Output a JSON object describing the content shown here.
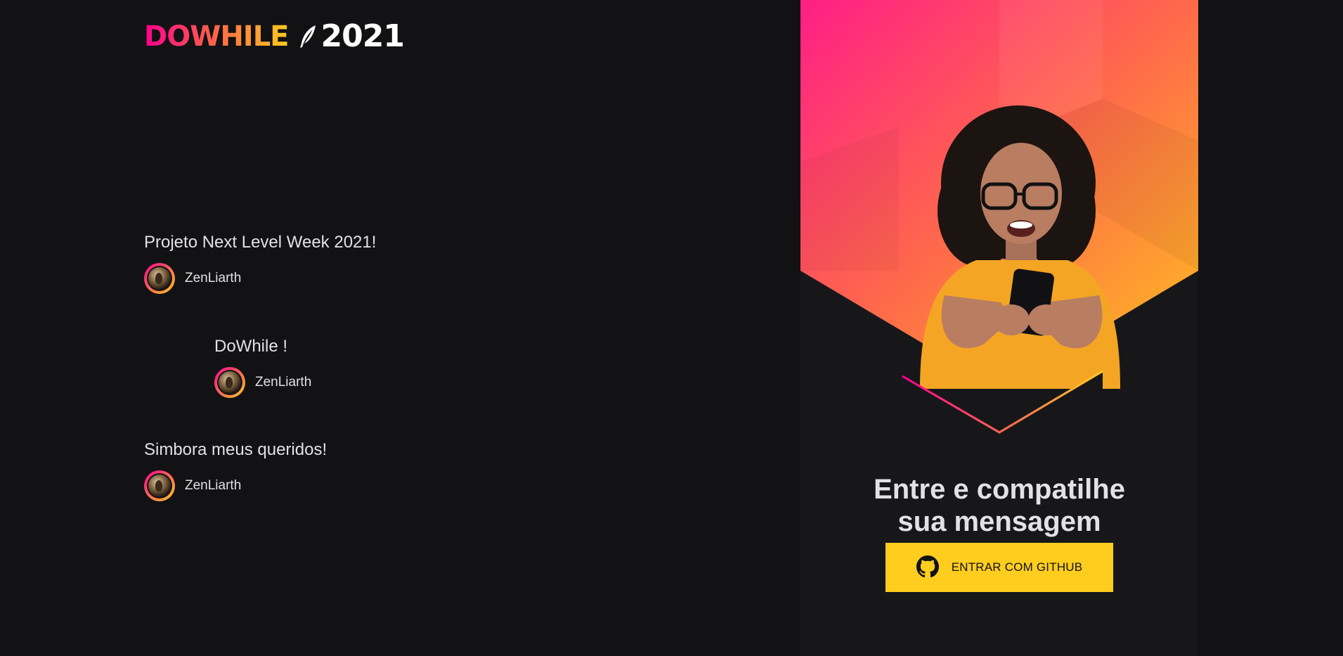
{
  "header": {
    "logo_text": "DOWHILE",
    "logo_year": "2021",
    "logo_icon": "feather-icon"
  },
  "messages": [
    {
      "content": "Projeto Next Level Week 2021!",
      "user": "ZenLiarth"
    },
    {
      "content": "DoWhile !",
      "user": "ZenLiarth"
    },
    {
      "content": "Simbora meus queridos!",
      "user": "ZenLiarth"
    }
  ],
  "login": {
    "title_line1": "Entre e compatilhe",
    "title_line2": "sua mensagem",
    "button_label": "ENTRAR COM GITHUB",
    "button_icon": "github-icon"
  },
  "colors": {
    "background": "#121214",
    "panel": "#17171a",
    "accent_pink": "#ff008e",
    "accent_yellow": "#ffcd1e",
    "text": "#e1e1e6"
  }
}
